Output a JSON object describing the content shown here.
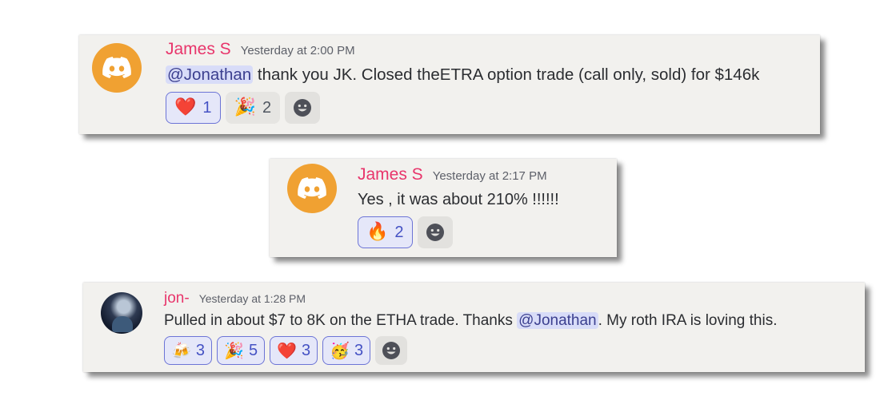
{
  "messages": [
    {
      "username": "James S",
      "timestamp": "Yesterday at 2:00 PM",
      "avatar": "discord-logo-icon",
      "message_mention": "@Jonathan",
      "message_text": " thank you JK. Closed theETRA option trade (call only, sold) for $146k",
      "reactions": [
        {
          "emoji": "❤️",
          "icon": "heart-icon",
          "count": "1",
          "me": true
        },
        {
          "emoji": "🎉",
          "icon": "party-popper-icon",
          "count": "2",
          "me": false
        }
      ]
    },
    {
      "username": "James S",
      "timestamp": "Yesterday at 2:17 PM",
      "avatar": "discord-logo-icon",
      "message_text": "Yes , it was about 210% !!!!!!",
      "reactions": [
        {
          "emoji": "🔥",
          "icon": "fire-icon",
          "count": "2",
          "me": true
        }
      ]
    },
    {
      "username": "jon-",
      "timestamp": "Yesterday at 1:28 PM",
      "avatar": "user-photo-avatar",
      "message_text_before": "Pulled in about $7 to 8K on the ETHA trade.  Thanks ",
      "message_mention": "@Jonathan",
      "message_text_after": ". My roth IRA is loving this.",
      "reactions": [
        {
          "emoji": "🍻",
          "icon": "clinking-beers-icon",
          "count": "3",
          "me": true
        },
        {
          "emoji": "🎉",
          "icon": "party-popper-icon",
          "count": "5",
          "me": true
        },
        {
          "emoji": "❤️",
          "icon": "heart-icon",
          "count": "3",
          "me": true
        },
        {
          "emoji": "🥳",
          "icon": "partying-face-icon",
          "count": "3",
          "me": true
        }
      ]
    }
  ],
  "colors": {
    "username": "#e8356b",
    "mention_bg": "#d8dcf8",
    "avatar_bg": "#f0a132",
    "reaction_selected_border": "#6c74d6"
  }
}
